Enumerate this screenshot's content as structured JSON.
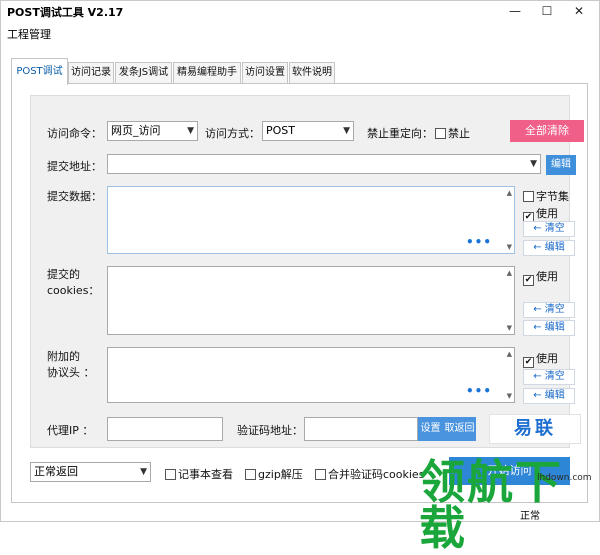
{
  "window": {
    "title": "POST调试工具 V2.17",
    "minimize": "—",
    "maximize": "☐",
    "close": "✕"
  },
  "menu": {
    "project": "工程管理"
  },
  "tabs": [
    {
      "label": "POST调试"
    },
    {
      "label": "访问记录"
    },
    {
      "label": "发条JS调试"
    },
    {
      "label": "精易编程助手"
    },
    {
      "label": "访问设置"
    },
    {
      "label": "软件说明"
    }
  ],
  "request": {
    "command_label": "访问命令：",
    "command_value": "网页_访问",
    "method_label": "访问方式：",
    "method_value": "POST",
    "redirect_label": "禁止重定向：",
    "redirect_checkbox": "禁止",
    "clear_all": "全部清除",
    "url_label": "提交地址：",
    "url_value": "",
    "edit": "编辑"
  },
  "data_section": {
    "label": "提交数据：",
    "bytes_checkbox": "字节集",
    "use_checkbox": "使用",
    "clear_link": "← 清空",
    "edit_link": "← 编辑",
    "more": "•••"
  },
  "cookies_section": {
    "label_line1": "提交的",
    "label_line2": "cookies：",
    "use_checkbox": "使用",
    "clear_link": "← 清空",
    "edit_link": "← 编辑"
  },
  "headers_section": {
    "label_line1": "附加的",
    "label_line2": "协议头  ：",
    "use_checkbox": "使用",
    "clear_link": "← 清空",
    "edit_link": "← 编辑",
    "more": "•••"
  },
  "proxy": {
    "proxy_label": "代理IP  ：",
    "captcha_label": "验证码地址：",
    "set_btn": "设置",
    "back_btn": "取返回",
    "logo": "易联"
  },
  "bottom": {
    "return_mode": "正常返回",
    "notepad_checkbox": "记事本查看",
    "gzip_checkbox": "gzip解压",
    "merge_checkbox": "合并验证码cookies",
    "start": "开始访问",
    "status": "正常"
  },
  "watermark": {
    "text": "领航下载",
    "site": "lhdown.com"
  }
}
